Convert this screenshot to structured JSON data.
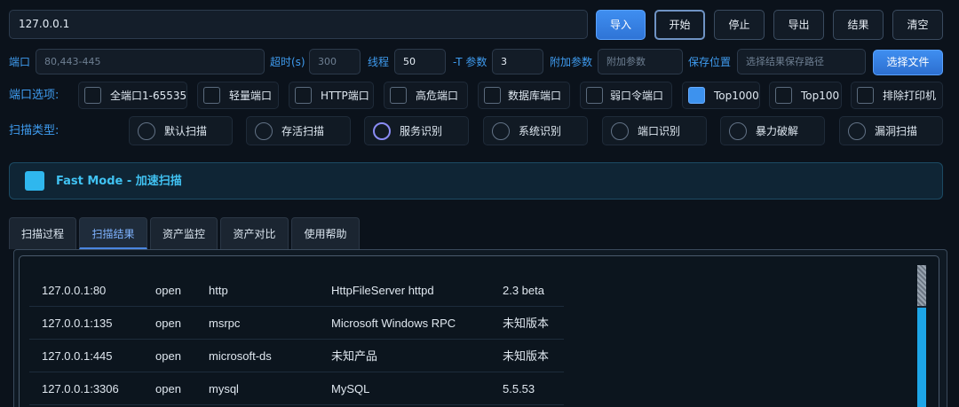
{
  "target": {
    "value": "127.0.0.1"
  },
  "actions": {
    "import": "导入",
    "start": "开始",
    "stop": "停止",
    "export": "导出",
    "results": "结果",
    "clear": "清空"
  },
  "params": {
    "port_label": "端口",
    "port_placeholder": "80,443-445",
    "timeout_label": "超时(s)",
    "timeout_placeholder": "300",
    "threads_label": "线程",
    "threads_value": "50",
    "t_label": "-T 参数",
    "t_value": "3",
    "extra_label": "附加参数",
    "extra_placeholder": "附加参数",
    "save_label": "保存位置",
    "save_placeholder": "选择结果保存路径",
    "choose_file": "选择文件"
  },
  "port_options": {
    "label": "端口选项:",
    "items": [
      {
        "label": "全端口1-65535",
        "checked": false
      },
      {
        "label": "轻量端口",
        "checked": false
      },
      {
        "label": "HTTP端口",
        "checked": false
      },
      {
        "label": "高危端口",
        "checked": false
      },
      {
        "label": "数据库端口",
        "checked": false
      },
      {
        "label": "弱口令端口",
        "checked": false
      },
      {
        "label": "Top1000",
        "checked": true
      },
      {
        "label": "Top100",
        "checked": false
      },
      {
        "label": "排除打印机",
        "checked": false
      }
    ]
  },
  "scan_types": {
    "label": "扫描类型:",
    "items": [
      {
        "label": "默认扫描",
        "selected": false
      },
      {
        "label": "存活扫描",
        "selected": false
      },
      {
        "label": "服务识别",
        "selected": true
      },
      {
        "label": "系统识别",
        "selected": false
      },
      {
        "label": "端口识别",
        "selected": false
      },
      {
        "label": "暴力破解",
        "selected": false
      },
      {
        "label": "漏洞扫描",
        "selected": false
      }
    ]
  },
  "fast_mode": {
    "label": "Fast Mode - 加速扫描",
    "checked": true
  },
  "tabs": [
    {
      "label": "扫描过程"
    },
    {
      "label": "扫描结果",
      "active": true
    },
    {
      "label": "资产监控"
    },
    {
      "label": "资产对比"
    },
    {
      "label": "使用帮助"
    }
  ],
  "results": [
    {
      "address": "127.0.0.1:80",
      "state": "open",
      "service": "http",
      "product": "HttpFileServer httpd",
      "version": "2.3 beta"
    },
    {
      "address": "127.0.0.1:135",
      "state": "open",
      "service": "msrpc",
      "product": "Microsoft Windows RPC",
      "version": "未知版本"
    },
    {
      "address": "127.0.0.1:445",
      "state": "open",
      "service": "microsoft-ds",
      "product": "未知产品",
      "version": "未知版本"
    },
    {
      "address": "127.0.0.1:3306",
      "state": "open",
      "service": "mysql",
      "product": "MySQL",
      "version": "5.5.53"
    }
  ],
  "colors": {
    "accent": "#3f9cf0",
    "primary_button": "#3a89ec",
    "fast_mode": "#40c2f2",
    "checked": "#3d92ee",
    "radio_selected": "#8a8cf5"
  }
}
